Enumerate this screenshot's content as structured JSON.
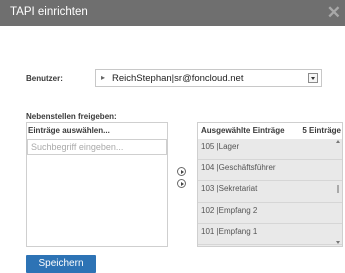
{
  "dialog": {
    "title": "TAPI einrichten",
    "close_icon": "close-icon"
  },
  "user": {
    "label": "Benutzer:",
    "value": "ReichStephan|sr@foncloud.net"
  },
  "extensions": {
    "section_label": "Nebenstellen freigeben:",
    "available_header": "Einträge auswählen...",
    "search_placeholder": "Suchbegriff eingeben...",
    "selected_header": "Ausgewählte Einträge",
    "selected_count": "5 Einträge",
    "selected_items": [
      "105 |Lager",
      "104 |Geschäftsführer",
      "103 |Sekretariat",
      "102 |Empfang 2",
      "101 |Empfang 1"
    ]
  },
  "actions": {
    "save_label": "Speichern"
  },
  "colors": {
    "titlebar": "#6f6f6f",
    "primary_button": "#2d73b5",
    "list_background": "#e9e9e9"
  }
}
